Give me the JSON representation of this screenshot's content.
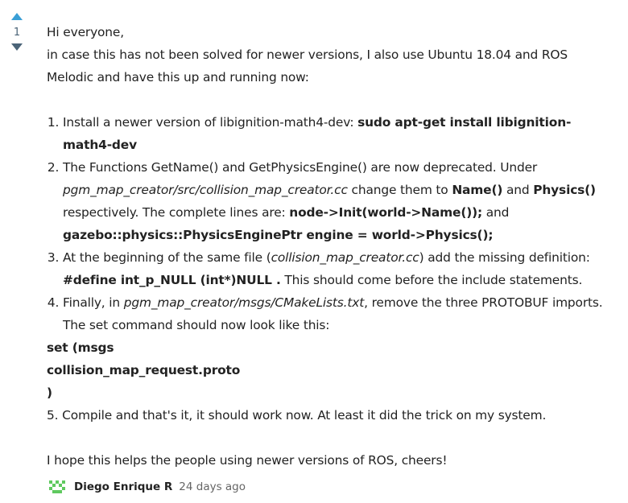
{
  "vote": {
    "count": "1"
  },
  "post": {
    "greeting": "Hi everyone,",
    "intro": "in case this has not been solved for newer versions, I also use Ubuntu 18.04 and ROS Melodic and have this up and running now:",
    "steps": [
      {
        "a": "Install a newer version of libignition-math4-dev: ",
        "cmd": "sudo apt-get install libignition-math4-dev"
      },
      {
        "a": "The Functions GetName() and GetPhysicsEngine() are now deprecated. Under ",
        "path": "pgm_map_creator/src/collision_map_creator.cc",
        "b": " change them to ",
        "name_fn": "Name()",
        "c": " and ",
        "physics_fn": "Physics()",
        "d": " respectively. The complete lines are: ",
        "line1": "node->Init(world->Name());",
        "e": " and ",
        "line2": "gazebo::physics::PhysicsEnginePtr engine = world->Physics();"
      },
      {
        "a": "At the beginning of the same file (",
        "file": "collision_map_creator.cc",
        "b": ") add the missing definition: ",
        "define": "#define int_p_NULL (int*)NULL .",
        "c": " This should come before the include statements."
      },
      {
        "a": "Finally, in ",
        "path": "pgm_map_creator/msgs/CMakeLists.txt",
        "b": ", remove the three PROTOBUF imports. The set command should now look like this:"
      }
    ],
    "code_lines": [
      "set (msgs",
      "collision_map_request.proto",
      ")"
    ],
    "step5": "5. Compile and that's it, it should work now. At least it did the trick on my system.",
    "closing": "I hope this helps the people using newer versions of ROS, cheers!"
  },
  "author": {
    "name": "Diego Enrique R",
    "time": "24 days ago",
    "avatar_color": "#5fc95f"
  },
  "colors": {
    "upvote": "#3a9fd6",
    "downvote": "#4b6478"
  }
}
